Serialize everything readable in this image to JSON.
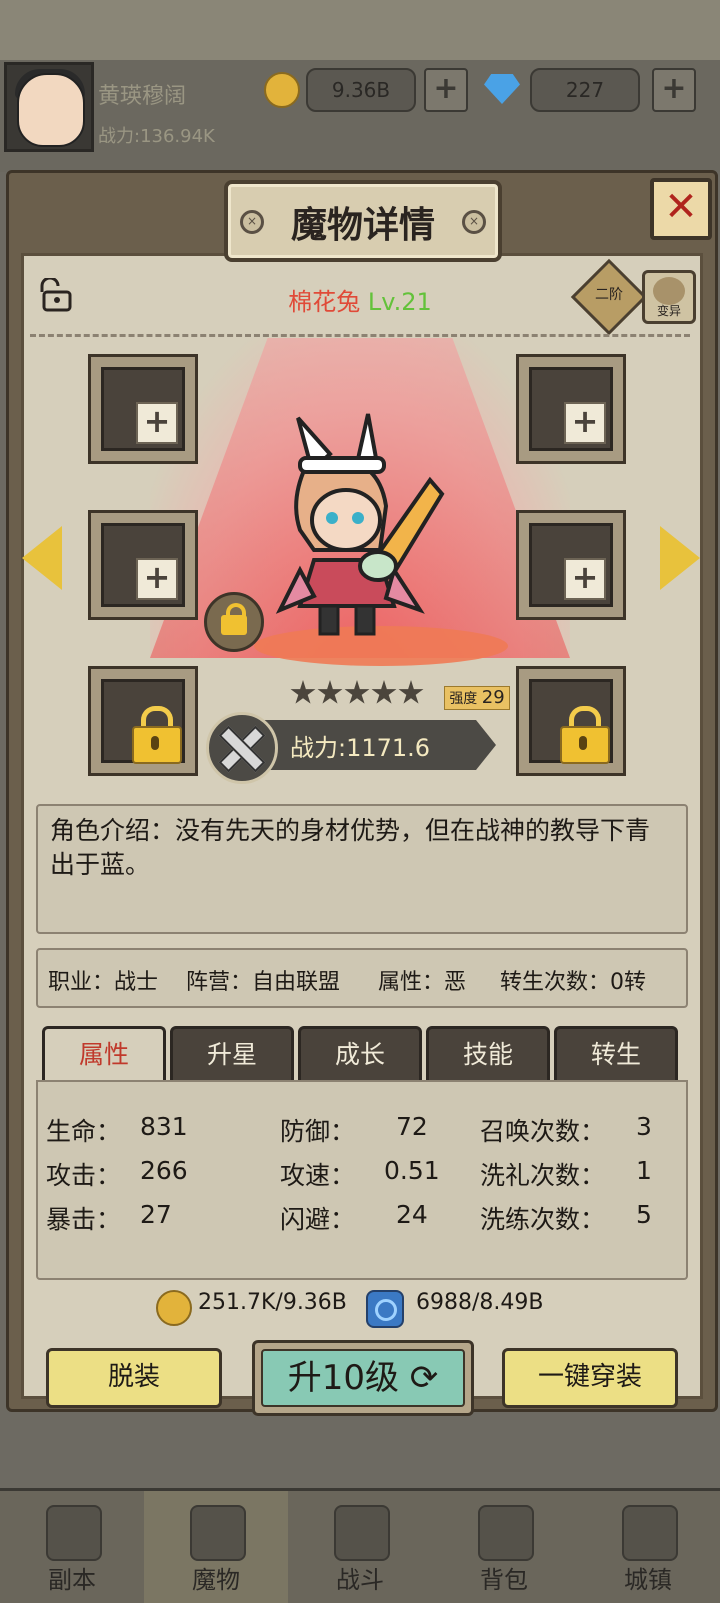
{
  "top": {
    "player_name": "黄瑛穆阔",
    "power": "战力:136.94K",
    "gold": "9.36B",
    "gems": "227"
  },
  "panel": {
    "title": "魔物详情",
    "close": "✕"
  },
  "monster": {
    "name": "棉花兔",
    "level": "Lv.21",
    "tier": "二阶",
    "mutate": "变异",
    "stars": 5,
    "strength_label": "强度",
    "strength_value": "29",
    "power": "战力:1171.6"
  },
  "description": "角色介绍：没有先天的身材优势，但在战神的教导下青出于蓝。",
  "info": {
    "job": "职业：战士",
    "camp": "阵营：自由联盟",
    "attr": "属性：恶",
    "reborn": "转生次数：0转"
  },
  "tabs": [
    {
      "label": "属性"
    },
    {
      "label": "升星"
    },
    {
      "label": "成长"
    },
    {
      "label": "技能"
    },
    {
      "label": "转生"
    }
  ],
  "stats": [
    {
      "label": "生命：",
      "value": "831"
    },
    {
      "label": "防御：",
      "value": "72"
    },
    {
      "label": "召唤次数：",
      "value": "3"
    },
    {
      "label": "攻击：",
      "value": "266"
    },
    {
      "label": "攻速：",
      "value": "0.51"
    },
    {
      "label": "洗礼次数：",
      "value": "1"
    },
    {
      "label": "暴击：",
      "value": "27"
    },
    {
      "label": "闪避：",
      "value": "24"
    },
    {
      "label": "洗练次数：",
      "value": "5"
    }
  ],
  "costs": {
    "gold": "251.7K/9.36B",
    "essence": "6988/8.49B"
  },
  "buttons": {
    "unequip": "脱装",
    "upgrade": "升10级",
    "equip_all": "一键穿装"
  },
  "nav": [
    {
      "label": "副本"
    },
    {
      "label": "魔物"
    },
    {
      "label": "战斗"
    },
    {
      "label": "背包"
    },
    {
      "label": "城镇"
    }
  ]
}
